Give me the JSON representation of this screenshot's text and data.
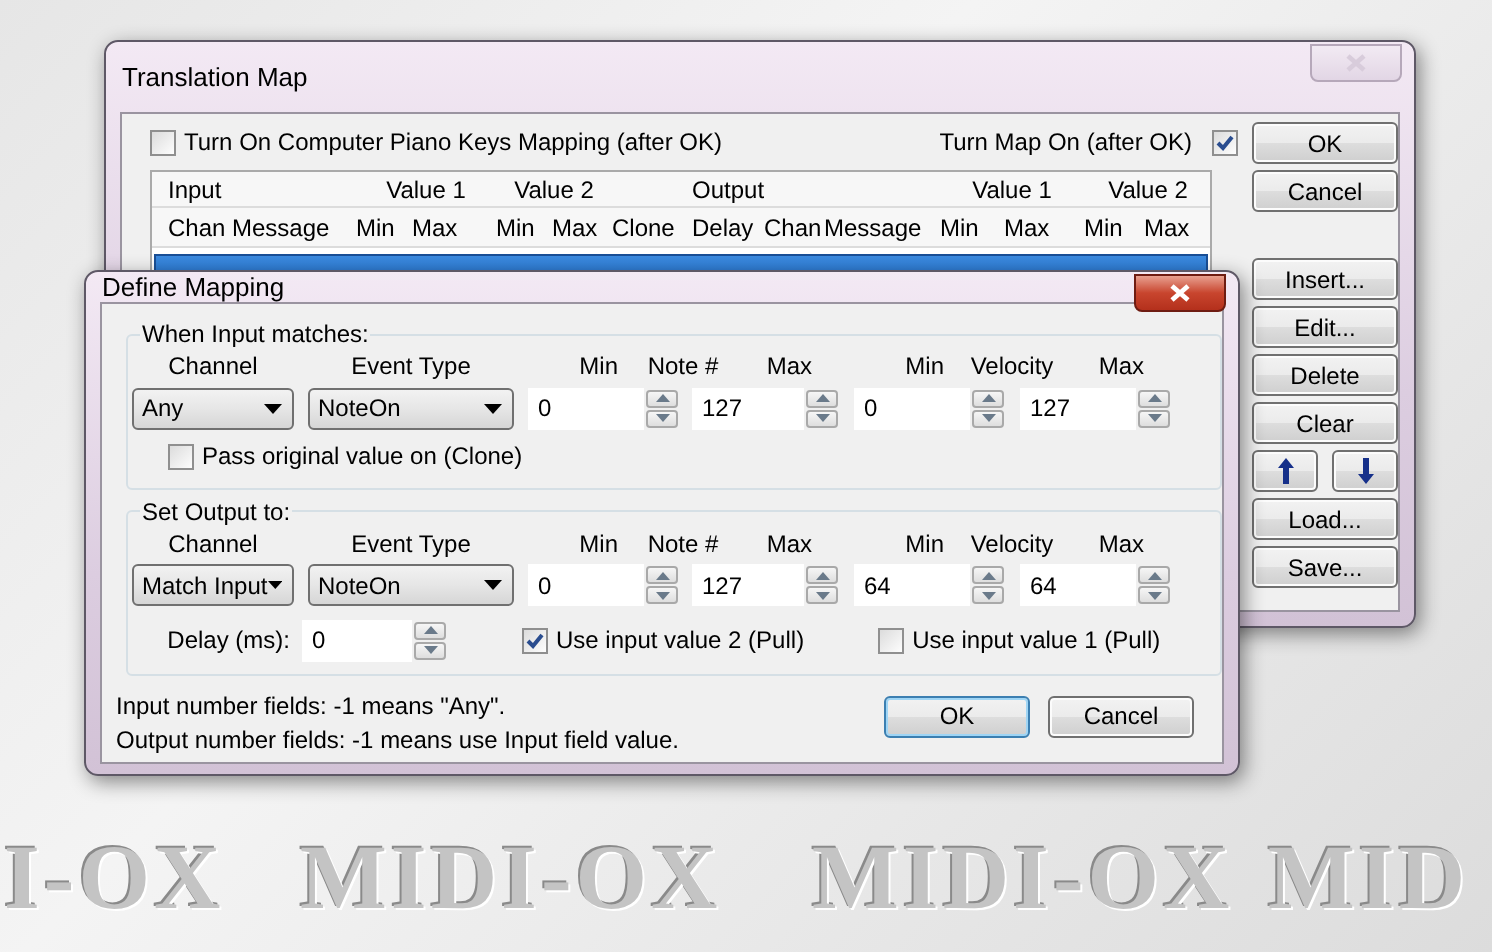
{
  "wallpaper_logos": [
    "I-OX",
    "MIDI-OX",
    "MIDI-OX",
    "MID"
  ],
  "translation_map": {
    "title": "Translation Map",
    "piano_keys": {
      "label": "Turn On Computer Piano Keys Mapping (after OK)",
      "checked": false
    },
    "map_on": {
      "label": "Turn Map On (after OK)",
      "checked": true
    },
    "list": {
      "input_label": "Input",
      "output_label": "Output",
      "input_groups": [
        "Value 1",
        "Value 2"
      ],
      "output_groups": [
        "Value 1",
        "Value 2"
      ],
      "input_columns": [
        "Chan",
        "Message",
        "Min",
        "Max",
        "Min",
        "Max",
        "Clone"
      ],
      "output_columns": [
        "Delay",
        "Chan",
        "Message",
        "Min",
        "Max",
        "Min",
        "Max"
      ],
      "rows": [
        {
          "selected": true
        }
      ]
    },
    "buttons": [
      {
        "kind": "text",
        "label": "OK"
      },
      {
        "kind": "text",
        "label": "Cancel"
      },
      {
        "kind": "spacer"
      },
      {
        "kind": "text",
        "label": "Insert..."
      },
      {
        "kind": "text",
        "label": "Edit..."
      },
      {
        "kind": "text",
        "label": "Delete"
      },
      {
        "kind": "text",
        "label": "Clear"
      },
      {
        "kind": "arrows"
      },
      {
        "kind": "text",
        "label": "Load..."
      },
      {
        "kind": "text",
        "label": "Save..."
      }
    ]
  },
  "define_mapping": {
    "title": "Define Mapping",
    "input_group": {
      "title": "When Input matches:",
      "channel": {
        "label": "Channel",
        "value": "Any"
      },
      "event_type": {
        "label": "Event Type",
        "value": "NoteOn"
      },
      "value1": {
        "min_label": "Min",
        "label": "Note #",
        "max_label": "Max",
        "min": "0",
        "max": "127"
      },
      "value2": {
        "min_label": "Min",
        "label": "Velocity",
        "max_label": "Max",
        "min": "0",
        "max": "127"
      }
    },
    "clone": {
      "label": "Pass original value on (Clone)",
      "checked": false
    },
    "output_group": {
      "title": "Set Output to:",
      "channel": {
        "label": "Channel",
        "value": "Match Input"
      },
      "event_type": {
        "label": "Event Type",
        "value": "NoteOn"
      },
      "value1": {
        "min_label": "Min",
        "label": "Note #",
        "max_label": "Max",
        "min": "0",
        "max": "127"
      },
      "value2": {
        "min_label": "Min",
        "label": "Velocity",
        "max_label": "Max",
        "min": "64",
        "max": "64"
      },
      "delay": {
        "label": "Delay (ms):",
        "value": "0"
      },
      "use_value2": {
        "label": "Use input value 2 (Pull)",
        "checked": true
      },
      "use_value1": {
        "label": "Use input value 1 (Pull)",
        "checked": false
      }
    },
    "notes": [
      "Input number fields: -1 means \"Any\".",
      "Output number fields: -1 means use Input field value."
    ],
    "buttons": [
      {
        "label": "OK",
        "default": true
      },
      {
        "label": "Cancel",
        "default": false
      }
    ]
  }
}
